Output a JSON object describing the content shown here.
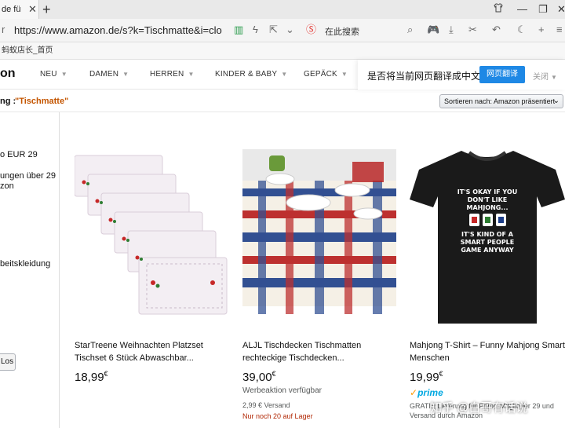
{
  "browser": {
    "tab_title": "de fü",
    "url": "https://www.amazon.de/s?k=Tischmatte&i=clothing",
    "search_label": "在此搜索",
    "bookmark": "蚂蚁店长_首页"
  },
  "nav": {
    "logo": "on",
    "categories": [
      "NEU",
      "DAMEN",
      "HERREN",
      "KINDER & BABY",
      "GEPÄCK"
    ]
  },
  "translate_bar": {
    "question": "是否将当前网页翻译成中文",
    "button": "网页翻译",
    "close": "关闭"
  },
  "results": {
    "prefix": "ng :",
    "query": "\"Tischmatte\"",
    "sort_label": "Sortieren nach: Amazon präsentiert"
  },
  "sidebar": {
    "items": [
      "o EUR 29",
      "ungen über 29",
      "zon",
      "beitskleidung"
    ],
    "button": "Los"
  },
  "products": [
    {
      "title": "StarTreene Weihnachten Platzset Tischset 6 Stück Abwaschbar...",
      "price": "18,99",
      "currency": "€"
    },
    {
      "title": "ALJL Tischdecken Tischmatten rechteckige Tischdecken...",
      "price": "39,00",
      "currency": "€",
      "promo": "Werbeaktion verfügbar",
      "shipping": "2,99 € Versand",
      "stock": "Nur noch 20 auf Lager"
    },
    {
      "title": "Mahjong T-Shirt – Funny Mahjong Smart Menschen",
      "price": "19,99",
      "currency": "€",
      "prime_check": "✓",
      "prime": "prime",
      "prime_text": "GRATIS Lieferung für Prime-Mitglieder 29 und Versand durch Amazon",
      "shirt_text": [
        "IT'S OKAY IF YOU",
        "DON'T LIKE",
        "MAHJONG...",
        "IT'S KIND OF A",
        "SMART PEOPLE",
        "GAME ANYWAY"
      ]
    }
  ],
  "watermark": "知乎 @白哥有话说"
}
